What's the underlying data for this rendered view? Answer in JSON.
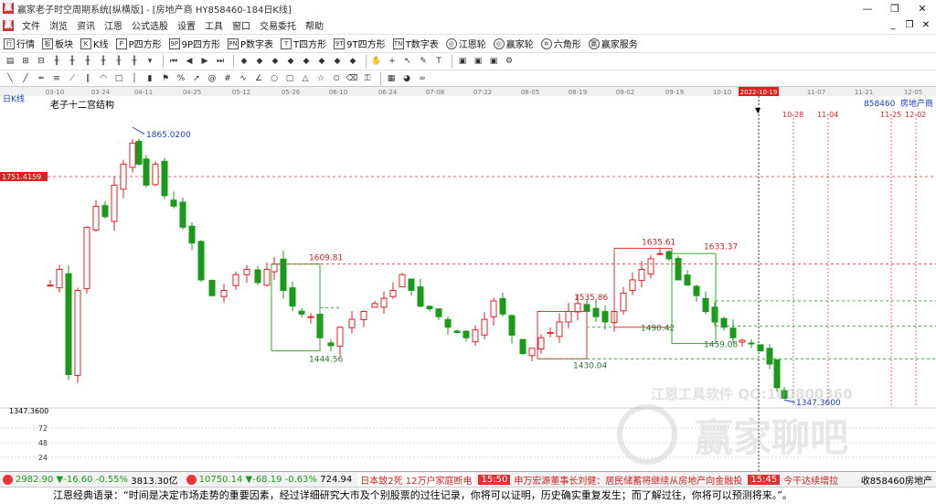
{
  "window": {
    "title": "赢家老子时空周期系统[纵横版] - [房地产商  HY858460-184日K线]",
    "min": "—",
    "max": "❐",
    "close": "✕"
  },
  "menu": [
    "文件",
    "浏览",
    "资讯",
    "江恩",
    "公式选股",
    "设置",
    "工具",
    "窗口",
    "交易委托",
    "帮助"
  ],
  "toolbar1": [
    {
      "icon": "行",
      "label": "行情"
    },
    {
      "icon": "板",
      "label": "板块"
    },
    {
      "icon": "K",
      "label": "K线"
    },
    {
      "icon": "P",
      "label": "P四方形"
    },
    {
      "icon": "9P",
      "label": "9P四方形"
    },
    {
      "icon": "PN",
      "label": "P数字表"
    },
    {
      "icon": "T",
      "label": "T四方形"
    },
    {
      "icon": "9T",
      "label": "9T四方形"
    },
    {
      "icon": "TN",
      "label": "T数字表"
    },
    {
      "icon": "◎",
      "label": "江恩轮"
    },
    {
      "icon": "◎",
      "label": "赢家轮"
    },
    {
      "icon": "✡",
      "label": "六角形"
    },
    {
      "icon": "赢",
      "label": "赢家服务"
    }
  ],
  "chart": {
    "period_label": "日K线",
    "structure_label": "老子十二宫结构",
    "stock_code": "858460",
    "stock_name": "房地产商",
    "date_axis": [
      "03-10",
      "03-24",
      "04-11",
      "04-25",
      "05-12",
      "05-26",
      "06-10",
      "06-24",
      "07-08",
      "07-22",
      "08-05",
      "08-19",
      "09-02",
      "09-19",
      "10-10",
      "2022-10-19",
      "11-07",
      "11-21",
      "12-05"
    ],
    "future_dates": [
      "10-28",
      "11-04",
      "11-25",
      "12-02"
    ],
    "price_marker": "1751.4159",
    "low_label": "1347.3600",
    "high_label": "1865.0200",
    "min_label": "1347.3600",
    "levels": [
      "1609.81",
      "1444.56",
      "1535.86",
      "1430.04",
      "1635.61",
      "1490.42",
      "1633.37",
      "1459.08"
    ],
    "volume_ticks": [
      "72",
      "48",
      "24"
    ],
    "watermark1": "江恩工具软件  QQ:100800360",
    "watermark2": "赢家聊吧"
  },
  "status": {
    "sh_index": "2982.90",
    "sh_change": "▼-16.60",
    "sh_pct": "-0.55%",
    "sh_amount": "3813.30亿",
    "sz_index": "10750.14",
    "sz_change": "▼-68.19",
    "sz_pct": "-0.63%",
    "sz_amount": "724.94",
    "news1": "日本致2死 12万户家庭断电",
    "time1": "15:50",
    "ticker": "申万宏源董事长刘健：居民储蓄将继续从房地产向金融投",
    "time2": "15:45",
    "ticker2": "今干达续增拉",
    "right_label": "收858460房地产"
  },
  "quote": "江恩经典语录：“时间是决定市场走势的重要因素，经过详细研究大市及个别股票的过往记录，你将可以证明，历史确实重复发生；而了解过往，你将可以预测将来。”。",
  "colors": {
    "up": "#e02020",
    "down": "#1a9a1a",
    "accent": "#d11",
    "level_red": "#d33",
    "level_green": "#3a3"
  }
}
